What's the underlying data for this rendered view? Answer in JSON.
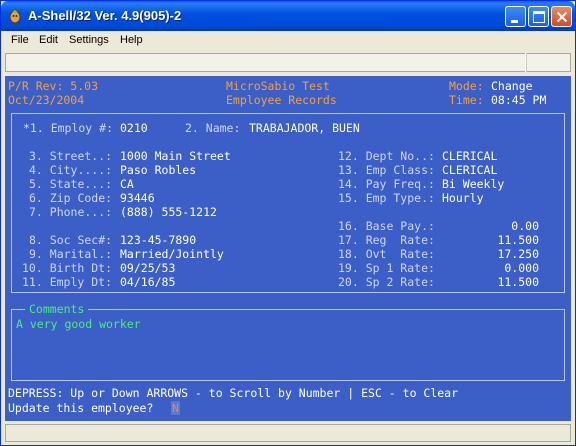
{
  "window": {
    "title": "A-Shell/32 Ver. 4.9(905)-2"
  },
  "menu": {
    "file": "File",
    "edit": "Edit",
    "settings": "Settings",
    "help": "Help"
  },
  "header": {
    "rev": "P/R Rev: 5.03",
    "date": "Oct/23/2004",
    "company": "MicroSabio Test",
    "screen_title": "Employee Records",
    "mode_label": "Mode:",
    "mode_value": "Change",
    "time_label": "Time:",
    "time_value": "08:45 PM"
  },
  "record": {
    "f1_label": "*1. Employ #:",
    "f1_value": "0210",
    "f2_label": "2. Name:",
    "f2_value": "TRABAJADOR, BUEN",
    "left_fields": [
      {
        "label": "3. Street..:",
        "value": "1000 Main Street"
      },
      {
        "label": "4. City....:",
        "value": "Paso Robles"
      },
      {
        "label": "5. State...:",
        "value": "CA"
      },
      {
        "label": "6. Zip Code:",
        "value": "93446"
      },
      {
        "label": "7. Phone...:",
        "value": "(888) 555-1212"
      },
      {
        "label": "8. Soc Sec#:",
        "value": "123-45-7890"
      },
      {
        "label": "9. Marital.:",
        "value": "Married/Jointly"
      },
      {
        "label": "10. Birth Dt:",
        "value": "09/25/53"
      },
      {
        "label": "11. Emply Dt:",
        "value": "04/16/85"
      }
    ],
    "right_fields": [
      {
        "label": "12. Dept No..:",
        "value": "CLERICAL"
      },
      {
        "label": "13. Emp Class:",
        "value": "CLERICAL"
      },
      {
        "label": "14. Pay Freq.:",
        "value": "Bi Weekly"
      },
      {
        "label": "15. Emp Type.:",
        "value": "Hourly"
      },
      {
        "label": "16. Base Pay.:",
        "value": "0.00"
      },
      {
        "label": "17. Reg  Rate:",
        "value": "11.500"
      },
      {
        "label": "18. Ovt  Rate:",
        "value": "17.250"
      },
      {
        "label": "19. Sp 1 Rate:",
        "value": "0.000"
      },
      {
        "label": "20. Sp 2 Rate:",
        "value": "11.500"
      }
    ]
  },
  "comments": {
    "label": "Comments",
    "text": "A very good worker"
  },
  "footer": {
    "help_line": "DEPRESS: Up or Down ARROWS - to Scroll by Number | ESC - to Clear",
    "prompt": "Update this employee?",
    "input_value": "N"
  },
  "colors": {
    "terminal_bg": "#3b5ec7",
    "header_accent": "#f5a13a",
    "comments_text": "#48f07a",
    "titlebar": "#0054e3"
  }
}
